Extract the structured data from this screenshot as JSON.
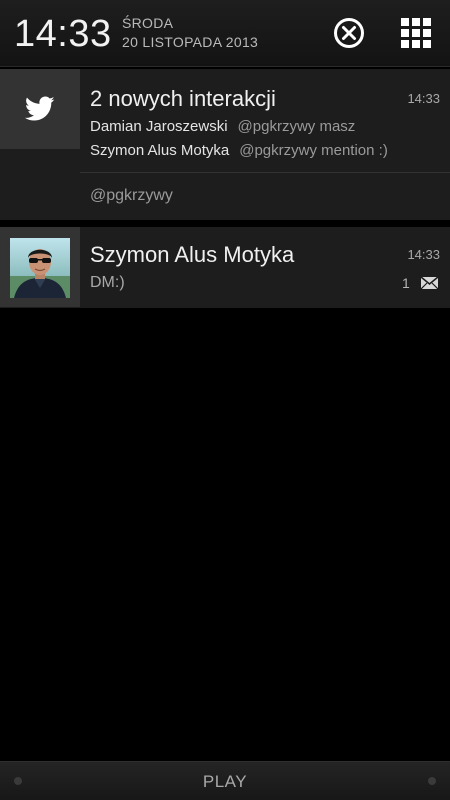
{
  "status": {
    "time": "14:33",
    "day": "ŚRODA",
    "date": "20 LISTOPADA 2013"
  },
  "header": {
    "clear_icon": "close-circle-icon",
    "settings_icon": "grid-icon"
  },
  "notifications": [
    {
      "app_icon": "twitter-icon",
      "title": "2 nowych interakcji",
      "time": "14:33",
      "lines": [
        {
          "user": "Damian Jaroszewski",
          "text": "@pgkrzywy masz"
        },
        {
          "user": "Szymon Alus Motyka",
          "text": "@pgkrzywy mention :)"
        }
      ],
      "footer": "@pgkrzywy"
    },
    {
      "app_icon": "avatar",
      "title": "Szymon Alus Motyka",
      "time": "14:33",
      "text": "DM:)",
      "count": "1",
      "badge_icon": "mail-icon"
    }
  ],
  "carrier": "PLAY",
  "colors": {
    "background": "#000000",
    "notification_bg": "#1d1d1d",
    "icon_box_bg": "#333333",
    "text_primary": "#f0f0f0",
    "text_secondary": "#9a9a9a"
  }
}
